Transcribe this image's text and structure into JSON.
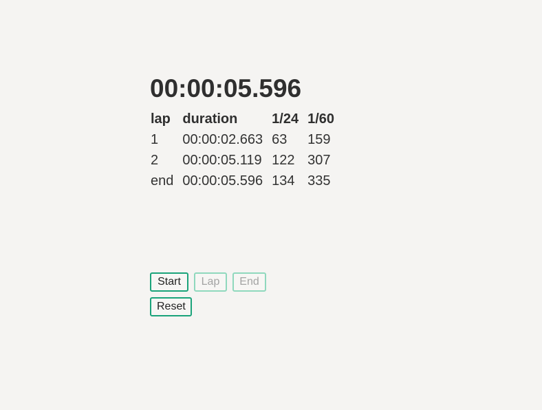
{
  "stopwatch": {
    "elapsed": "00:00:05.596"
  },
  "laps_table": {
    "headers": [
      "lap",
      "duration",
      "1/24",
      "1/60"
    ],
    "rows": [
      [
        "1",
        "00:00:02.663",
        "63",
        "159"
      ],
      [
        "2",
        "00:00:05.119",
        "122",
        "307"
      ],
      [
        "end",
        "00:00:05.596",
        "134",
        "335"
      ]
    ]
  },
  "controls": {
    "start_label": "Start",
    "lap_label": "Lap",
    "end_label": "End",
    "reset_label": "Reset",
    "lap_enabled": false,
    "end_enabled": false
  },
  "colors": {
    "background": "#f5f4f2",
    "button_border": "#1aa37a",
    "button_border_disabled": "#8fd8bd"
  }
}
